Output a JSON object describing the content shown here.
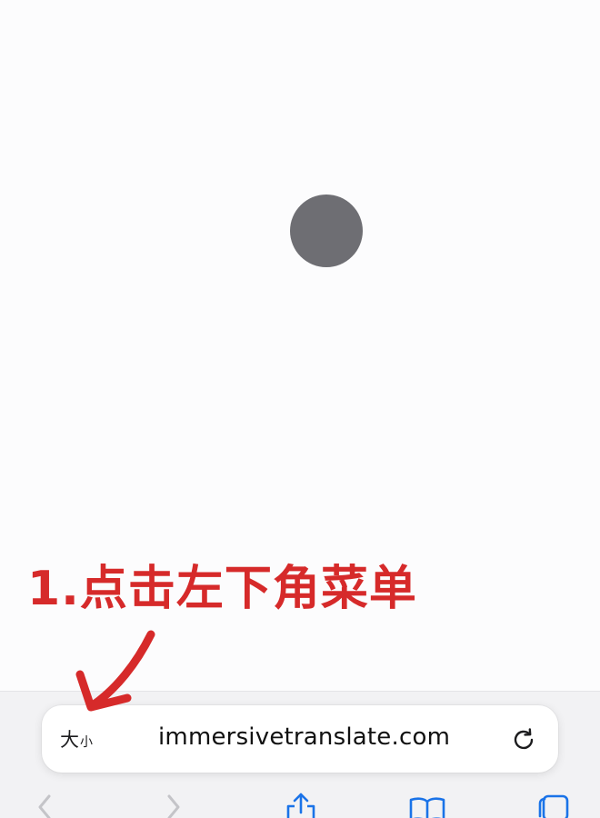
{
  "annotation": {
    "instruction": "1.点击左下角菜单",
    "color": "#d62a2a"
  },
  "browser": {
    "page_settings": {
      "large": "大",
      "small": "小",
      "icon": "aa-text-size-icon"
    },
    "address_bar": {
      "url": "immersivetranslate.com"
    },
    "reload_icon": "reload-icon",
    "toolbar": {
      "items": [
        "back-icon",
        "forward-icon",
        "share-icon",
        "bookmarks-icon",
        "tabs-icon"
      ]
    }
  },
  "page": {
    "loading_indicator": "gray-circle",
    "indicator_color": "#6e6e73"
  }
}
